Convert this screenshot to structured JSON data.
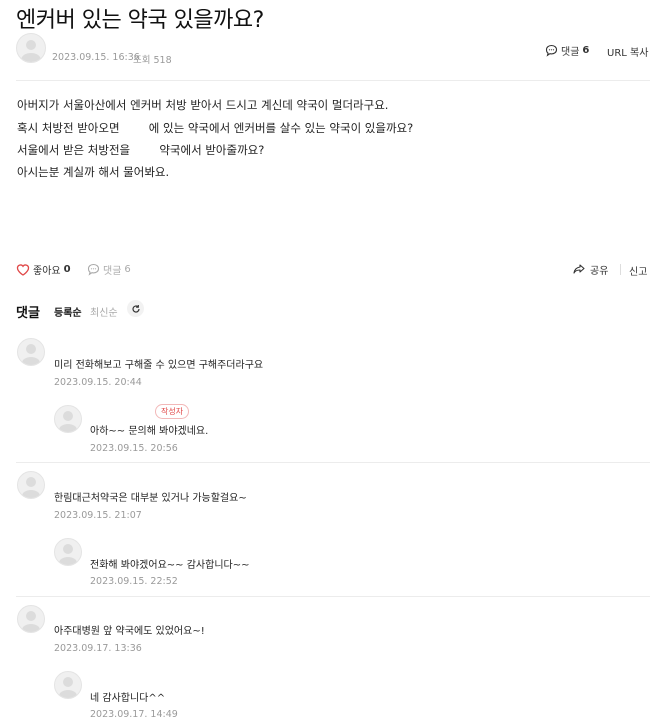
{
  "post": {
    "title": "엔커버 있는 약국 있을까요?",
    "date": "2023.09.15. 16:36",
    "views_label": "조회 518",
    "comment_label": "댓글",
    "comment_count": "6",
    "url_copy": "URL 복사",
    "body": [
      "아버지가 서울아산에서 엔커버 처방 받아서 드시고 계신데 약국이 멀더라구요.",
      "혹시 처방전 받아오면        에 있는 약국에서 엔커버를 살수 있는 약국이 있을까요?",
      "서울에서 받은 처방전을        약국에서 받아줄까요?",
      "아시는분 계실까 해서 물어봐요."
    ]
  },
  "actions": {
    "like_label": "좋아요",
    "like_count": "0",
    "comment_label": "댓글",
    "comment_count": "6",
    "share_label": "공유",
    "report_label": "신고"
  },
  "comments_header": {
    "title": "댓글",
    "sort_registered": "등록순",
    "sort_latest": "최신순"
  },
  "comments": [
    {
      "text": "미리 전화해보고 구해줄 수 있으면 구해주더라구요",
      "date": "2023.09.15. 20:44"
    },
    {
      "text": "아하~~ 문의해 봐야겠네요.",
      "date": "2023.09.15. 20:56",
      "badge": "작성자"
    },
    {
      "text": "한림대근처약국은 대부분 있거나 가능할걸요~",
      "date": "2023.09.15. 21:07"
    },
    {
      "text": "전화해 봐야겠어요~~ 감사합니다~~",
      "date": "2023.09.15. 22:52"
    },
    {
      "text": "아주대병원 앞 약국에도 있었어요~!",
      "date": "2023.09.17. 13:36"
    },
    {
      "text": "네 감사합니다^^",
      "date": "2023.09.17. 14:49"
    }
  ],
  "colors": {
    "heart": "#e04848",
    "badge": "#e04848",
    "divider": "#ececec"
  }
}
